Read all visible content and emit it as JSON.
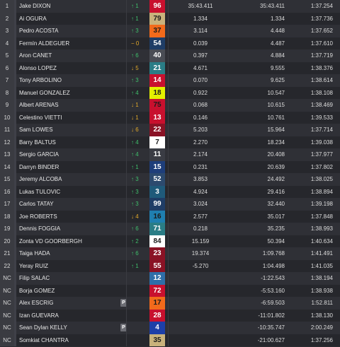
{
  "rows": [
    {
      "pos": "1",
      "name": "Jake DIXON",
      "chg": "↑ 1",
      "dir": "up",
      "num": "96",
      "color": "#c8102e",
      "tcolor": "#ffffff",
      "c1": "35:43.411",
      "c2": "35:43.411",
      "c3": "1:37.254",
      "badge": ""
    },
    {
      "pos": "2",
      "name": "Ai OGURA",
      "chg": "↑ 1",
      "dir": "up",
      "num": "79",
      "color": "#c9b27c",
      "tcolor": "#1a1a1a",
      "c1": "1.334",
      "c2": "1.334",
      "c3": "1:37.736",
      "badge": ""
    },
    {
      "pos": "3",
      "name": "Pedro ACOSTA",
      "chg": "↑ 3",
      "dir": "up",
      "num": "37",
      "color": "#f26a1b",
      "tcolor": "#1a1a1a",
      "c1": "3.114",
      "c2": "4.448",
      "c3": "1:37.652",
      "badge": ""
    },
    {
      "pos": "4",
      "name": "Fermín ALDEGUER",
      "chg": "− 0",
      "dir": "same",
      "num": "54",
      "color": "#1f3d66",
      "tcolor": "#ffffff",
      "c1": "0.039",
      "c2": "4.487",
      "c3": "1:37.610",
      "badge": ""
    },
    {
      "pos": "5",
      "name": "Aron CANET",
      "chg": "↑ 6",
      "dir": "up",
      "num": "40",
      "color": "#4a4d55",
      "tcolor": "#ffffff",
      "c1": "0.397",
      "c2": "4.884",
      "c3": "1:37.719",
      "badge": ""
    },
    {
      "pos": "6",
      "name": "Alonso LOPEZ",
      "chg": "↓ 5",
      "dir": "down",
      "num": "21",
      "color": "#2a7d86",
      "tcolor": "#ffffff",
      "c1": "4.671",
      "c2": "9.555",
      "c3": "1:38.376",
      "badge": ""
    },
    {
      "pos": "7",
      "name": "Tony ARBOLINO",
      "chg": "↑ 3",
      "dir": "up",
      "num": "14",
      "color": "#c8102e",
      "tcolor": "#ffffff",
      "c1": "0.070",
      "c2": "9.625",
      "c3": "1:38.614",
      "badge": ""
    },
    {
      "pos": "8",
      "name": "Manuel GONZALEZ",
      "chg": "↑ 4",
      "dir": "up",
      "num": "18",
      "color": "#e4f000",
      "tcolor": "#1a1a1a",
      "c1": "0.922",
      "c2": "10.547",
      "c3": "1:38.108",
      "badge": ""
    },
    {
      "pos": "9",
      "name": "Albert ARENAS",
      "chg": "↓ 1",
      "dir": "down",
      "num": "75",
      "color": "#c8102e",
      "tcolor": "#1a1a1a",
      "c1": "0.068",
      "c2": "10.615",
      "c3": "1:38.469",
      "badge": ""
    },
    {
      "pos": "10",
      "name": "Celestino VIETTI",
      "chg": "↓ 1",
      "dir": "down",
      "num": "13",
      "color": "#c8102e",
      "tcolor": "#ffffff",
      "c1": "0.146",
      "c2": "10.761",
      "c3": "1:39.533",
      "badge": ""
    },
    {
      "pos": "11",
      "name": "Sam LOWES",
      "chg": "↓ 6",
      "dir": "down",
      "num": "22",
      "color": "#8a1225",
      "tcolor": "#ffffff",
      "c1": "5.203",
      "c2": "15.964",
      "c3": "1:37.714",
      "badge": ""
    },
    {
      "pos": "12",
      "name": "Barry BALTUS",
      "chg": "↑ 4",
      "dir": "up",
      "num": "7",
      "color": "#ffffff",
      "tcolor": "#1a1a1a",
      "c1": "2.270",
      "c2": "18.234",
      "c3": "1:39.038",
      "badge": ""
    },
    {
      "pos": "13",
      "name": "Sergio GARCIA",
      "chg": "↑ 4",
      "dir": "up",
      "num": "11",
      "color": "#3a3c44",
      "tcolor": "#ffffff",
      "c1": "2.174",
      "c2": "20.408",
      "c3": "1:37.977",
      "badge": ""
    },
    {
      "pos": "14",
      "name": "Darryn BINDER",
      "chg": "↑ 1",
      "dir": "up",
      "num": "15",
      "color": "#1e3e7a",
      "tcolor": "#ffffff",
      "c1": "0.231",
      "c2": "20.639",
      "c3": "1:37.802",
      "badge": ""
    },
    {
      "pos": "15",
      "name": "Jeremy ALCOBA",
      "chg": "↑ 3",
      "dir": "up",
      "num": "52",
      "color": "#2c4a6e",
      "tcolor": "#ffffff",
      "c1": "3.853",
      "c2": "24.492",
      "c3": "1:38.025",
      "badge": ""
    },
    {
      "pos": "16",
      "name": "Lukas TULOVIC",
      "chg": "↑ 3",
      "dir": "up",
      "num": "3",
      "color": "#1f5a7a",
      "tcolor": "#ffffff",
      "c1": "4.924",
      "c2": "29.416",
      "c3": "1:38.894",
      "badge": ""
    },
    {
      "pos": "17",
      "name": "Carlos TATAY",
      "chg": "↑ 3",
      "dir": "up",
      "num": "99",
      "color": "#1f3d66",
      "tcolor": "#ffffff",
      "c1": "3.024",
      "c2": "32.440",
      "c3": "1:39.198",
      "badge": ""
    },
    {
      "pos": "18",
      "name": "Joe ROBERTS",
      "chg": "↓ 4",
      "dir": "down",
      "num": "16",
      "color": "#1f7fb0",
      "tcolor": "#1a1a1a",
      "c1": "2.577",
      "c2": "35.017",
      "c3": "1:37.848",
      "badge": ""
    },
    {
      "pos": "19",
      "name": "Dennis FOGGIA",
      "chg": "↑ 6",
      "dir": "up",
      "num": "71",
      "color": "#2a7d86",
      "tcolor": "#ffffff",
      "c1": "0.218",
      "c2": "35.235",
      "c3": "1:38.993",
      "badge": ""
    },
    {
      "pos": "20",
      "name": "Zonta VD GOORBERGH",
      "chg": "↑ 2",
      "dir": "up",
      "num": "84",
      "color": "#ffffff",
      "tcolor": "#1a1a1a",
      "c1": "15.159",
      "c2": "50.394",
      "c3": "1:40.634",
      "badge": ""
    },
    {
      "pos": "21",
      "name": "Taiga HADA",
      "chg": "↑ 6",
      "dir": "up",
      "num": "23",
      "color": "#8a1225",
      "tcolor": "#ffffff",
      "c1": "19.374",
      "c2": "1:09.768",
      "c3": "1:41.491",
      "badge": ""
    },
    {
      "pos": "22",
      "name": "Yeray RUIZ",
      "chg": "↑ 1",
      "dir": "up",
      "num": "55",
      "color": "#8a1225",
      "tcolor": "#ffffff",
      "c1": "-5.270",
      "c2": "1:04.498",
      "c3": "1:41.035",
      "badge": ""
    },
    {
      "pos": "NC",
      "name": "Filip SALAC",
      "chg": "",
      "dir": "",
      "num": "12",
      "color": "#2f6ea8",
      "tcolor": "#ffffff",
      "c1": "",
      "c2": "-1:22.543",
      "c3": "1:38.194",
      "badge": ""
    },
    {
      "pos": "NC",
      "name": "Borja GOMEZ",
      "chg": "",
      "dir": "",
      "num": "72",
      "color": "#c8102e",
      "tcolor": "#ffffff",
      "c1": "",
      "c2": "-5:53.160",
      "c3": "1:38.938",
      "badge": ""
    },
    {
      "pos": "NC",
      "name": "Alex ESCRIG",
      "chg": "",
      "dir": "",
      "num": "17",
      "color": "#f26a1b",
      "tcolor": "#1a1a1a",
      "c1": "",
      "c2": "-6:59.503",
      "c3": "1:52.811",
      "badge": "P"
    },
    {
      "pos": "NC",
      "name": "Izan GUEVARA",
      "chg": "",
      "dir": "",
      "num": "28",
      "color": "#c8102e",
      "tcolor": "#ffffff",
      "c1": "",
      "c2": "-11:01.802",
      "c3": "1:38.130",
      "badge": ""
    },
    {
      "pos": "NC",
      "name": "Sean Dylan KELLY",
      "chg": "",
      "dir": "",
      "num": "4",
      "color": "#1d3fa8",
      "tcolor": "#ffffff",
      "c1": "",
      "c2": "-10:35.747",
      "c3": "2:00.249",
      "badge": "P"
    },
    {
      "pos": "NC",
      "name": "Somkiat CHANTRA",
      "chg": "",
      "dir": "",
      "num": "35",
      "color": "#c9b27c",
      "tcolor": "#1a1a1a",
      "c1": "",
      "c2": "-21:00.627",
      "c3": "1:37.256",
      "badge": ""
    }
  ]
}
